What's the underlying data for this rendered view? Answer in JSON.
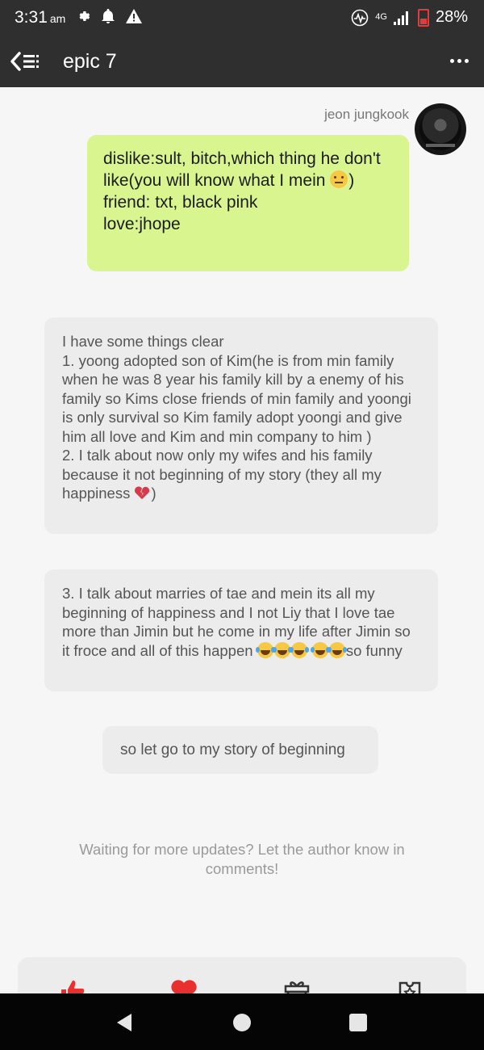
{
  "status_bar": {
    "time": "3:31",
    "ampm": "am",
    "network": "4G",
    "battery": "28%"
  },
  "app_bar": {
    "title": "epic 7"
  },
  "author": {
    "name": "jeon jungkook"
  },
  "messages": {
    "author_bubble": {
      "line1": "dislike:sult, bitch,which thing he don't like(you will know what I mein ",
      "line1_end": ")",
      "line2": "friend: txt, black pink",
      "line3": "love:jhope"
    },
    "note1": "I have some things clear\n1. yoong adopted son of Kim(he is from min family when he was 8 year his family kill by a enemy of his family so Kims close friends of min family and yoongi is only survival so Kim family adopt yoongi and give him all love and Kim and min company to him )\n2. I talk about now only my wifes and his family because it not beginning of my story (they all my happiness ",
    "note1_end": ")",
    "note2": "3. I talk about marries of tae and mein its all my beginning of happiness and I not Liy that I love tae more than Jimin but he come in my life after Jimin so it froce and all of this happen ",
    "note2_end": "so funny",
    "note3": "so let go to my story of beginning"
  },
  "footer_note": "Waiting for more updates? Let the author know in comments!",
  "icons": {
    "like": "thumbs-up-icon",
    "heart": "heart-icon",
    "gift": "gift-icon",
    "ticket": "ticket-icon"
  },
  "colors": {
    "app_bar": "#2f2f2f",
    "author_bubble": "#d8f58f",
    "note_bubble": "#ececec",
    "accent_red": "#e8312f"
  }
}
